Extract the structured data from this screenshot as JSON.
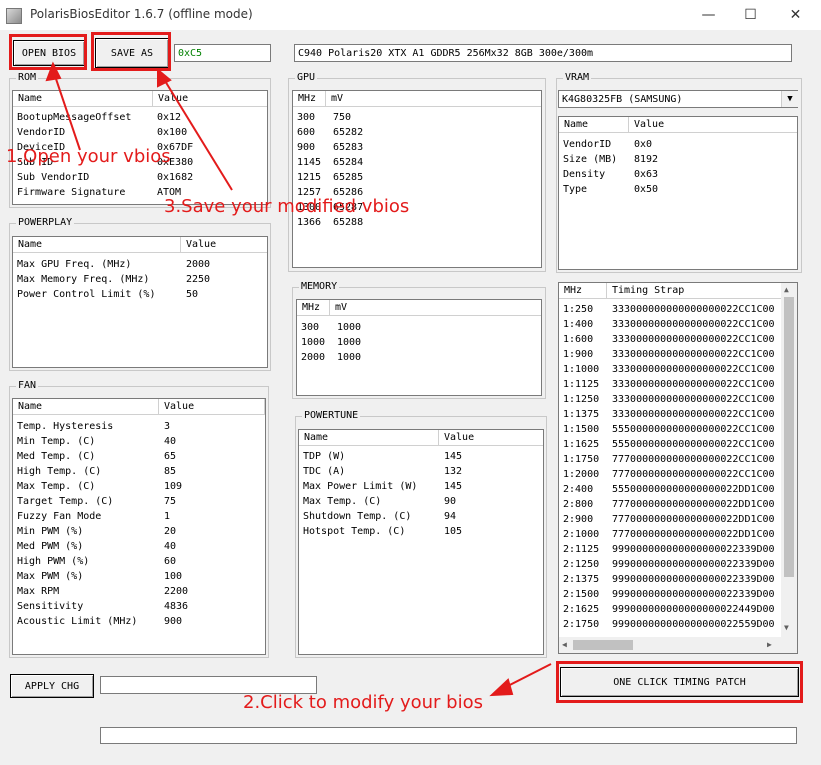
{
  "window": {
    "title": "PolarisBiosEditor 1.6.7 (offline mode)",
    "minimize": "—",
    "maximize": "☐",
    "close": "✕"
  },
  "toolbar": {
    "open_label": "OPEN BIOS",
    "save_label": "SAVE AS",
    "checksum": "0xC5",
    "bios_name": "C940 Polaris20 XTX A1 GDDR5 256Mx32 8GB 300e/300m"
  },
  "rom": {
    "title": "ROM",
    "col_name": "Name",
    "col_value": "Value",
    "rows": [
      {
        "name": "BootupMessageOffset",
        "value": "0x12"
      },
      {
        "name": "VendorID",
        "value": "0x100"
      },
      {
        "name": "DeviceID",
        "value": "0x67DF"
      },
      {
        "name": "Sub ID",
        "value": "0xE380"
      },
      {
        "name": "Sub VendorID",
        "value": "0x1682"
      },
      {
        "name": "Firmware Signature",
        "value": "ATOM"
      }
    ]
  },
  "powerplay": {
    "title": "POWERPLAY",
    "col_name": "Name",
    "col_value": "Value",
    "rows": [
      {
        "name": "Max GPU Freq. (MHz)",
        "value": "2000"
      },
      {
        "name": "Max Memory Freq. (MHz)",
        "value": "2250"
      },
      {
        "name": "Power Control Limit (%)",
        "value": "50"
      }
    ]
  },
  "fan": {
    "title": "FAN",
    "col_name": "Name",
    "col_value": "Value",
    "rows": [
      {
        "name": "Temp. Hysteresis",
        "value": "3"
      },
      {
        "name": "Min Temp. (C)",
        "value": "40"
      },
      {
        "name": "Med Temp. (C)",
        "value": "65"
      },
      {
        "name": "High Temp. (C)",
        "value": "85"
      },
      {
        "name": "Max Temp. (C)",
        "value": "109"
      },
      {
        "name": "Target Temp. (C)",
        "value": "75"
      },
      {
        "name": "Fuzzy Fan Mode",
        "value": "1"
      },
      {
        "name": "Min PWM (%)",
        "value": "20"
      },
      {
        "name": "Med PWM (%)",
        "value": "40"
      },
      {
        "name": "High PWM (%)",
        "value": "60"
      },
      {
        "name": "Max PWM (%)",
        "value": "100"
      },
      {
        "name": "Max RPM",
        "value": "2200"
      },
      {
        "name": "Sensitivity",
        "value": "4836"
      },
      {
        "name": "Acoustic Limit (MHz)",
        "value": "900"
      }
    ]
  },
  "gpu": {
    "title": "GPU",
    "col_mhz": "MHz",
    "col_mv": "mV",
    "rows": [
      {
        "mhz": "300",
        "mv": "750"
      },
      {
        "mhz": "600",
        "mv": "65282"
      },
      {
        "mhz": "900",
        "mv": "65283"
      },
      {
        "mhz": "1145",
        "mv": "65284"
      },
      {
        "mhz": "1215",
        "mv": "65285"
      },
      {
        "mhz": "1257",
        "mv": "65286"
      },
      {
        "mhz": "1300",
        "mv": "65287"
      },
      {
        "mhz": "1366",
        "mv": "65288"
      }
    ]
  },
  "memory": {
    "title": "MEMORY",
    "col_mhz": "MHz",
    "col_mv": "mV",
    "rows": [
      {
        "mhz": "300",
        "mv": "1000"
      },
      {
        "mhz": "1000",
        "mv": "1000"
      },
      {
        "mhz": "2000",
        "mv": "1000"
      }
    ]
  },
  "powertune": {
    "title": "POWERTUNE",
    "col_name": "Name",
    "col_value": "Value",
    "rows": [
      {
        "name": "TDP (W)",
        "value": "145"
      },
      {
        "name": "TDC (A)",
        "value": "132"
      },
      {
        "name": "Max Power Limit (W)",
        "value": "145"
      },
      {
        "name": "Max Temp. (C)",
        "value": "90"
      },
      {
        "name": "Shutdown Temp. (C)",
        "value": "94"
      },
      {
        "name": "Hotspot Temp. (C)",
        "value": "105"
      }
    ]
  },
  "vram": {
    "title": "VRAM",
    "selected": "K4G80325FB (SAMSUNG)",
    "col_name": "Name",
    "col_value": "Value",
    "rows": [
      {
        "name": "VendorID",
        "value": "0x0"
      },
      {
        "name": "Size (MB)",
        "value": "8192"
      },
      {
        "name": "Density",
        "value": "0x63"
      },
      {
        "name": "Type",
        "value": "0x50"
      }
    ]
  },
  "timing": {
    "col_mhz": "MHz",
    "col_strap": "Timing Strap",
    "rows": [
      {
        "mhz": "1:250",
        "strap": "333000000000000000022CC1C00"
      },
      {
        "mhz": "1:400",
        "strap": "333000000000000000022CC1C00"
      },
      {
        "mhz": "1:600",
        "strap": "333000000000000000022CC1C00"
      },
      {
        "mhz": "1:900",
        "strap": "333000000000000000022CC1C00"
      },
      {
        "mhz": "1:1000",
        "strap": "333000000000000000022CC1C00"
      },
      {
        "mhz": "1:1125",
        "strap": "333000000000000000022CC1C00"
      },
      {
        "mhz": "1:1250",
        "strap": "333000000000000000022CC1C00"
      },
      {
        "mhz": "1:1375",
        "strap": "333000000000000000022CC1C00"
      },
      {
        "mhz": "1:1500",
        "strap": "555000000000000000022CC1C00"
      },
      {
        "mhz": "1:1625",
        "strap": "555000000000000000022CC1C00"
      },
      {
        "mhz": "1:1750",
        "strap": "777000000000000000022CC1C00"
      },
      {
        "mhz": "1:2000",
        "strap": "777000000000000000022CC1C00"
      },
      {
        "mhz": "2:400",
        "strap": "555000000000000000022DD1C00"
      },
      {
        "mhz": "2:800",
        "strap": "777000000000000000022DD1C00"
      },
      {
        "mhz": "2:900",
        "strap": "777000000000000000022DD1C00"
      },
      {
        "mhz": "2:1000",
        "strap": "777000000000000000022DD1C00"
      },
      {
        "mhz": "2:1125",
        "strap": "999000000000000000022339D00"
      },
      {
        "mhz": "2:1250",
        "strap": "999000000000000000022339D00"
      },
      {
        "mhz": "2:1375",
        "strap": "999000000000000000022339D00"
      },
      {
        "mhz": "2:1500",
        "strap": "999000000000000000022339D00"
      },
      {
        "mhz": "2:1625",
        "strap": "999000000000000000022449D00"
      },
      {
        "mhz": "2:1750",
        "strap": "999000000000000000022559D00"
      }
    ]
  },
  "bottom": {
    "apply_label": "APPLY CHG",
    "apply_input": "",
    "one_click_label": "ONE CLICK TIMING PATCH",
    "status": ""
  },
  "annotations": {
    "open": "1.Open your vbios",
    "save": "3.Save your modified vbios",
    "modify": "2.Click to modify your bios"
  },
  "colors": {
    "annotation_red": "#e31b1b",
    "checksum_green": "#008000"
  }
}
